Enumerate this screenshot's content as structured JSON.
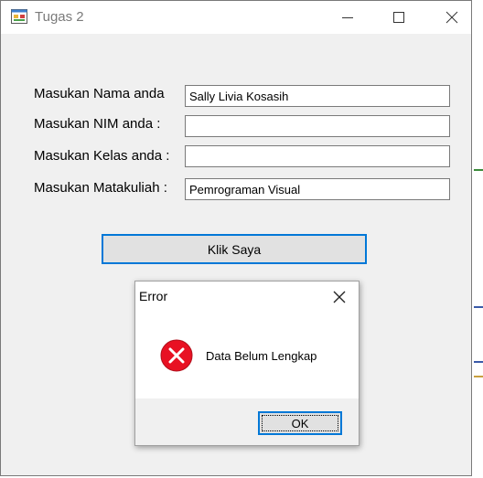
{
  "window": {
    "title": "Tugas 2"
  },
  "form": {
    "fields": [
      {
        "label": "Masukan Nama anda",
        "value": "Sally Livia Kosasih"
      },
      {
        "label": "Masukan NIM anda :",
        "value": ""
      },
      {
        "label": "Masukan Kelas anda :",
        "value": ""
      },
      {
        "label": "Masukan Matakuliah :",
        "value": "Pemrograman Visual"
      }
    ],
    "submit_label": "Klik Saya"
  },
  "dialog": {
    "title": "Error",
    "message": "Data Belum Lengkap",
    "ok_label": "OK",
    "icon": "error-icon"
  },
  "colors": {
    "accent": "#0078d7",
    "error_red": "#e81123",
    "window_bg": "#f0f0f0"
  }
}
